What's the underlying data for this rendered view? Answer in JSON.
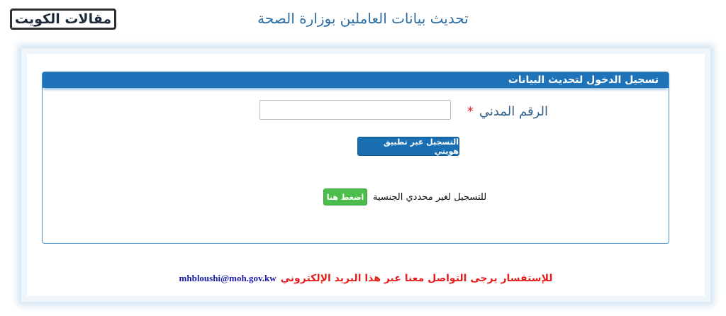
{
  "logo": {
    "text": "مقالات الكويت"
  },
  "page": {
    "title": "تحديث بيانات العاملين بوزارة الصحة"
  },
  "login_panel": {
    "header": "تسجيل الدخول لتحديث البيانات",
    "civil_id_label": "الرقم المدني",
    "required_marker": "*",
    "civil_id_value": "",
    "hawyti_button": "التسجيل عبر تطبيق هويتي",
    "stateless_label": "للتسجيل لغير محددي الجنسية",
    "click_here_button": "اضغط هنا"
  },
  "contact": {
    "text": "للإستفسار يرجى التواصل معنا عبر هذا البريد الإلكتروني",
    "email": "mhbloushi@moh.gov.kw"
  },
  "colors": {
    "header_blue": "#1e73b9",
    "title_blue": "#2f6ea3",
    "button_green": "#4cbd4c",
    "contact_red": "#e31c1c",
    "email_blue": "#1a1aa8"
  }
}
